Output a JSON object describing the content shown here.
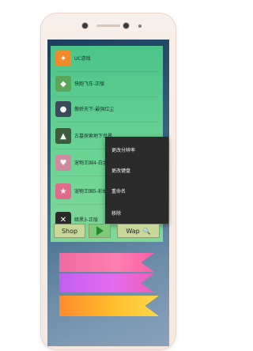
{
  "games": [
    {
      "name": "UC游戏",
      "icon": "uc-game-icon",
      "color": "#f08a2a"
    },
    {
      "name": "快跑飞车-正版",
      "icon": "racing-car-icon",
      "color": "#5aa65a"
    },
    {
      "name": "傲娇天下-最强红尘",
      "icon": "anime-girl-icon",
      "color": "#3a4a5a"
    },
    {
      "name": "古墓探索地下世界",
      "icon": "explorer-icon",
      "color": "#3c5c3c"
    },
    {
      "name": "宠物王国4-白金",
      "icon": "pet-kingdom-icon",
      "color": "#d08aa0"
    },
    {
      "name": "宠物王国5-彩虹",
      "icon": "pet-rainbow-icon",
      "color": "#e06a8a"
    },
    {
      "name": "暗黑3-正版",
      "icon": "dark-warrior-icon",
      "color": "#2a2a2a"
    }
  ],
  "context_menu": {
    "items": [
      "更改分辨率",
      "更改键盘",
      "重命名",
      "移除"
    ]
  },
  "toolbar": {
    "shop_label": "Shop",
    "wap_label": "Wap",
    "play_icon": "play-icon",
    "search_icon": "search-icon"
  },
  "colors": {
    "panel": "#5fcf8f",
    "menu_bg": "#2b2b2b",
    "toolbar_btn": "#c7d89a",
    "ribbon_pink": "#ff7fb0",
    "ribbon_purple": "#d565f0",
    "ribbon_orange": "#ffbf2d"
  }
}
